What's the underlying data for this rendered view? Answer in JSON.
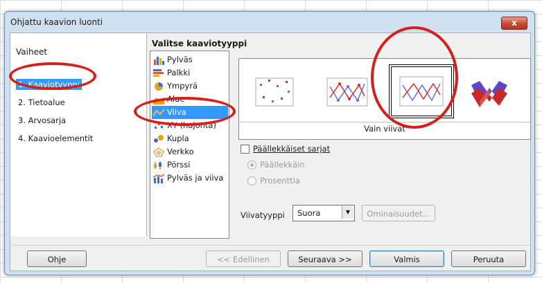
{
  "dialog": {
    "title": "Ohjattu kaavion luonti",
    "close_label": "x"
  },
  "steps": {
    "title": "Vaiheet",
    "items": [
      {
        "label": "1. Kaaviotyyppi",
        "selected": true
      },
      {
        "label": "2. Tietoalue",
        "selected": false
      },
      {
        "label": "3. Arvosarja",
        "selected": false
      },
      {
        "label": "4. Kaavioelementit",
        "selected": false
      }
    ]
  },
  "chart_type": {
    "title": "Valitse kaaviotyyppi",
    "types": [
      {
        "label": "Pylväs",
        "icon": "column-chart-icon"
      },
      {
        "label": "Palkki",
        "icon": "bar-chart-icon"
      },
      {
        "label": "Ympyrä",
        "icon": "pie-chart-icon"
      },
      {
        "label": "Alue",
        "icon": "area-chart-icon"
      },
      {
        "label": "Viiva",
        "icon": "line-chart-icon",
        "selected": true
      },
      {
        "label": "XY (hajonta)",
        "icon": "scatter-chart-icon"
      },
      {
        "label": "Kupla",
        "icon": "bubble-chart-icon"
      },
      {
        "label": "Verkko",
        "icon": "net-chart-icon"
      },
      {
        "label": "Pörssi",
        "icon": "stock-chart-icon"
      },
      {
        "label": "Pylväs ja viiva",
        "icon": "column-line-chart-icon"
      }
    ],
    "variants": [
      {
        "name": "points-only",
        "icon": "points-only-icon"
      },
      {
        "name": "points-and-lines",
        "icon": "points-lines-icon"
      },
      {
        "name": "lines-only",
        "icon": "lines-only-icon",
        "selected": true
      },
      {
        "name": "3d-lines",
        "icon": "3d-lines-icon"
      }
    ],
    "variant_caption": "Vain viivat"
  },
  "options": {
    "stacked_label": "Päällekkäiset sarjat",
    "stacked_checked": false,
    "on_top_label": "Päällekkäin",
    "percent_label": "Prosenttia",
    "line_type_label": "Viivatyyppi",
    "line_type_value": "Suora",
    "properties_label": "Ominaisuudet..."
  },
  "buttons": {
    "help": "Ohje",
    "back": "<< Edellinen",
    "next": "Seuraava >>",
    "finish": "Valmis",
    "cancel": "Peruuta"
  },
  "colors": {
    "selection": "#3399ff",
    "annotation": "#d4201a"
  }
}
